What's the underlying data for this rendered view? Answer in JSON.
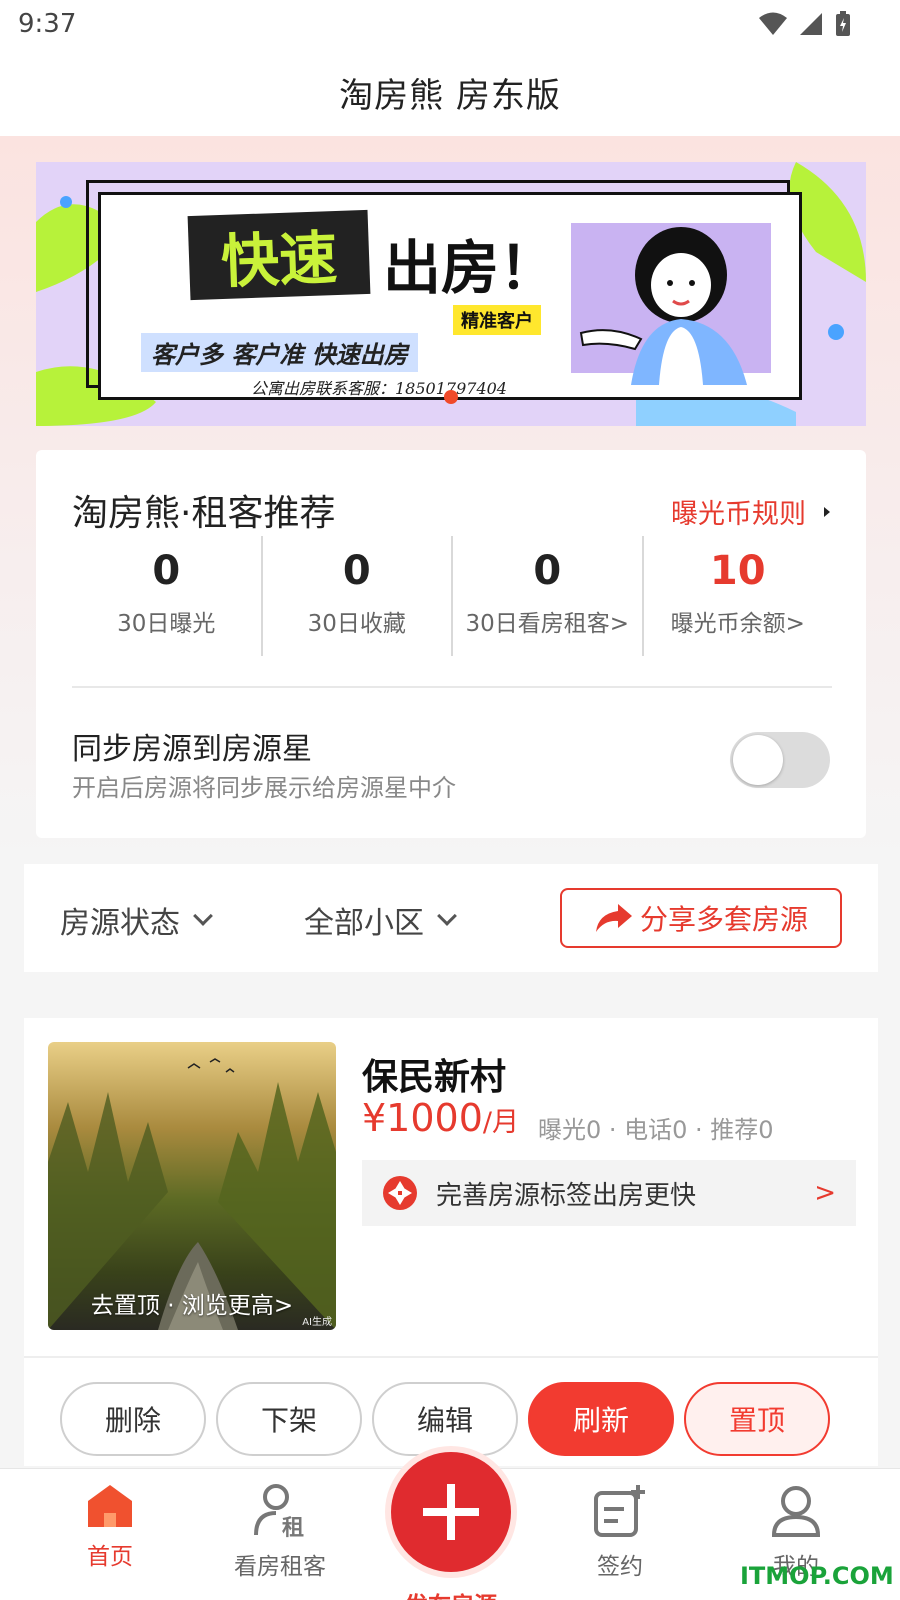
{
  "status_bar": {
    "time": "9:37"
  },
  "header": {
    "title": "淘房熊 房东版"
  },
  "banner": {
    "headline_1": "快速",
    "headline_2": "出房！",
    "tag": "精准客户",
    "slogan": "客户多 客户准 快速出房",
    "contact": "公寓出房联系客服：18501797404"
  },
  "recommend": {
    "title": "淘房熊·租客推荐",
    "rule_link": "曝光币规则",
    "stats": [
      {
        "value": "0",
        "label": "30日曝光"
      },
      {
        "value": "0",
        "label": "30日收藏"
      },
      {
        "value": "0",
        "label": "30日看房租客>"
      },
      {
        "value": "10",
        "label": "曝光币余额>"
      }
    ],
    "sync_title": "同步房源到房源星",
    "sync_desc": "开启后房源将同步展示给房源星中介",
    "sync_enabled": false
  },
  "filters": {
    "status": "房源状态",
    "community": "全部小区",
    "share": "分享多套房源"
  },
  "listing": {
    "name": "保民新村",
    "price": "¥1000",
    "unit": "/月",
    "meta": "曝光0 · 电话0 · 推荐0",
    "image_caption": "去置顶 · 浏览更高>",
    "image_badge": "AI生成",
    "tip": "完善房源标签出房更快",
    "tip_arrow": ">"
  },
  "actions": {
    "delete": "删除",
    "offline": "下架",
    "edit": "编辑",
    "refresh": "刷新",
    "top": "置顶"
  },
  "tabbar": {
    "home": "首页",
    "tenants": "看房租客",
    "publish": "发布房源",
    "sign": "签约",
    "mine": "我的"
  },
  "watermark": "ITMOP.COM",
  "colors": {
    "accent": "#e63a2e",
    "primary_button": "#f23b30"
  }
}
